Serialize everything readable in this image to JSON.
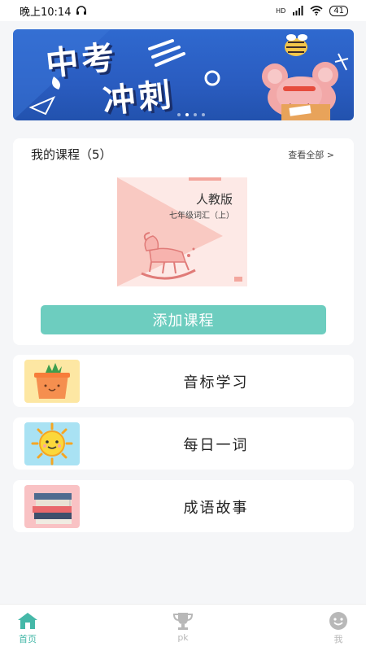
{
  "status_bar": {
    "time": "晚上10:14",
    "network": "HD",
    "battery": "41"
  },
  "banner": {
    "line1": "中考",
    "line2": "冲刺"
  },
  "courses": {
    "header": "我的课程（5）",
    "see_all": "查看全部 >",
    "book_title": "人教版",
    "book_subtitle": "七年级词汇（上）",
    "add_button": "添加课程"
  },
  "menu": [
    {
      "label": "音标学习",
      "icon": "plant-pot-icon"
    },
    {
      "label": "每日一词",
      "icon": "sun-icon"
    },
    {
      "label": "成语故事",
      "icon": "books-icon"
    }
  ],
  "tabs": [
    {
      "label": "首页",
      "icon": "home-icon",
      "active": true
    },
    {
      "label": "pk",
      "icon": "trophy-icon",
      "active": false
    },
    {
      "label": "我",
      "icon": "smiley-icon",
      "active": false
    }
  ],
  "colors": {
    "accent": "#6dcdbf",
    "tab_active": "#45b8a8",
    "tab_inactive": "#b8b8b8",
    "banner_bg": "#2f69cf"
  }
}
